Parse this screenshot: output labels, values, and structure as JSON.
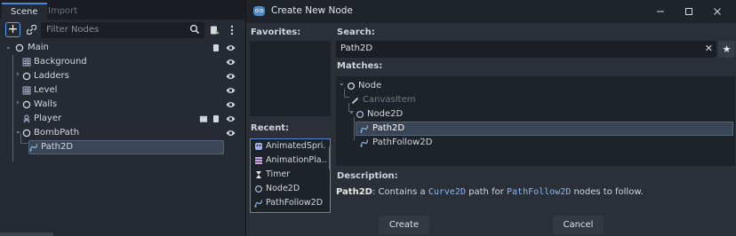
{
  "scene_dock": {
    "tabs": [
      "Scene",
      "Import"
    ],
    "filter_placeholder": "Filter Nodes",
    "tree": [
      {
        "name": "Main",
        "icon": "node-circle-icon"
      },
      {
        "name": "Background",
        "icon": "grid-icon"
      },
      {
        "name": "Ladders",
        "icon": "node-circle-icon"
      },
      {
        "name": "Level",
        "icon": "grid-icon"
      },
      {
        "name": "Walls",
        "icon": "node-circle-icon"
      },
      {
        "name": "Player",
        "icon": "player-icon"
      },
      {
        "name": "BombPath",
        "icon": "node-circle-icon"
      },
      {
        "name": "Path2D",
        "icon": "path2d-icon"
      }
    ]
  },
  "dialog": {
    "title": "Create New Node",
    "favorites_label": "Favorites:",
    "recent_label": "Recent:",
    "search_label": "Search:",
    "search_value": "Path2D",
    "matches_label": "Matches:",
    "matches": [
      {
        "name": "Node",
        "icon": "node-circle-icon"
      },
      {
        "name": "CanvasItem",
        "icon": "pencil-icon"
      },
      {
        "name": "Node2D",
        "icon": "node-circle-icon"
      },
      {
        "name": "Path2D",
        "icon": "path2d-icon"
      },
      {
        "name": "PathFollow2D",
        "icon": "path2d-icon"
      }
    ],
    "recent": [
      {
        "name": "AnimatedSpri...",
        "icon": "animated-sprite-icon"
      },
      {
        "name": "AnimationPla...",
        "icon": "animation-player-icon"
      },
      {
        "name": "Timer",
        "icon": "timer-icon"
      },
      {
        "name": "Node2D",
        "icon": "node-circle-icon"
      },
      {
        "name": "PathFollow2D",
        "icon": "path2d-icon"
      }
    ],
    "description_label": "Description:",
    "description": {
      "class_name": "Path2D",
      "part1": ": Contains a ",
      "code1": "Curve2D",
      "part2": " path for ",
      "code2": "PathFollow2D",
      "part3": " nodes to follow."
    },
    "create_label": "Create",
    "cancel_label": "Cancel"
  },
  "colors": {
    "accent": "#4a87d6",
    "path_blue": "#8fb8e8",
    "selection": "#3a4656"
  }
}
